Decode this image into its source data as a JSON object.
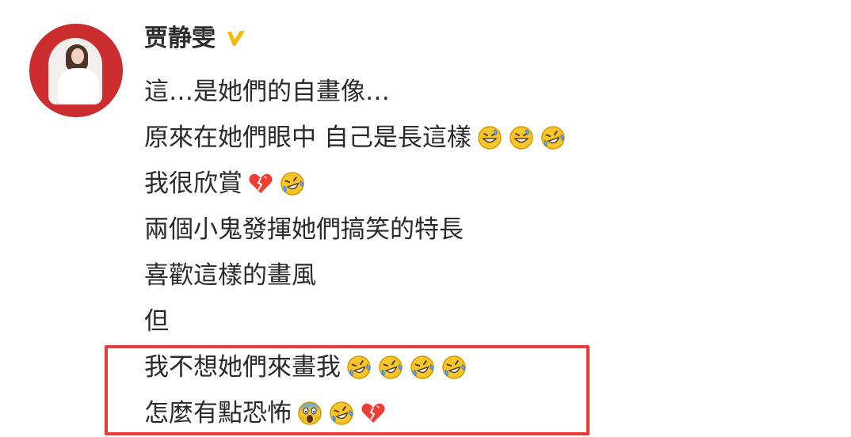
{
  "profile": {
    "username": "贾静雯",
    "verified_icon": "verified-v-icon",
    "avatar_icon": "profile-avatar",
    "accent_color": "#f6b800"
  },
  "post": {
    "lines": [
      {
        "text": "這…是她們的自畫像…",
        "emojis": []
      },
      {
        "text": "原來在她們眼中 自己是長這樣",
        "emojis": [
          "grinning-sweat-emoji-icon",
          "grinning-sweat-emoji-icon",
          "rolling-laughing-emoji-icon"
        ]
      },
      {
        "text": "我很欣賞",
        "emojis": [
          "broken-heart-emoji-icon",
          "rolling-laughing-emoji-icon"
        ]
      },
      {
        "text": "兩個小鬼發揮她們搞笑的特長",
        "emojis": []
      },
      {
        "text": "喜歡這樣的畫風",
        "emojis": []
      },
      {
        "text": "但",
        "emojis": []
      },
      {
        "text": "我不想她們來畫我",
        "emojis": [
          "rolling-laughing-emoji-icon",
          "rolling-laughing-emoji-icon",
          "rolling-laughing-emoji-icon",
          "rolling-laughing-emoji-icon"
        ]
      },
      {
        "text": "怎麼有點恐怖",
        "emojis": [
          "screaming-fear-emoji-icon",
          "rolling-laughing-emoji-icon",
          "broken-heart-emoji-icon"
        ]
      }
    ]
  },
  "highlight": {
    "color": "#ea3b3b"
  }
}
